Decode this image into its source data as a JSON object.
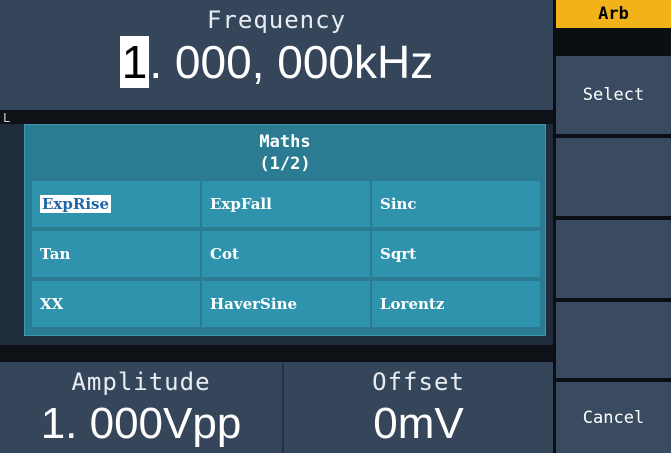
{
  "frequency": {
    "title": "Frequency",
    "cursor_digit": "1",
    "value_rest": ". 000, 000kHz"
  },
  "strip_mark": "L",
  "popup": {
    "title": "Maths",
    "page": "(1/2)",
    "items": [
      "ExpRise",
      "ExpFall",
      "Sinc",
      "Tan",
      "Cot",
      "Sqrt",
      "XX",
      "HaverSine",
      "Lorentz"
    ],
    "selected": "ExpRise"
  },
  "amplitude": {
    "title": "Amplitude",
    "value": "1. 000Vpp"
  },
  "offset": {
    "title": "Offset",
    "value": "0mV"
  },
  "softkeys": {
    "header": "Arb",
    "select": "Select",
    "key3": "",
    "key4": "",
    "key5": "",
    "cancel": "Cancel"
  },
  "colors": {
    "accent": "#f2b21a",
    "popup_bg": "#2b7c92",
    "cell_bg": "#2f93ad",
    "panel_bg": "#35455a"
  }
}
